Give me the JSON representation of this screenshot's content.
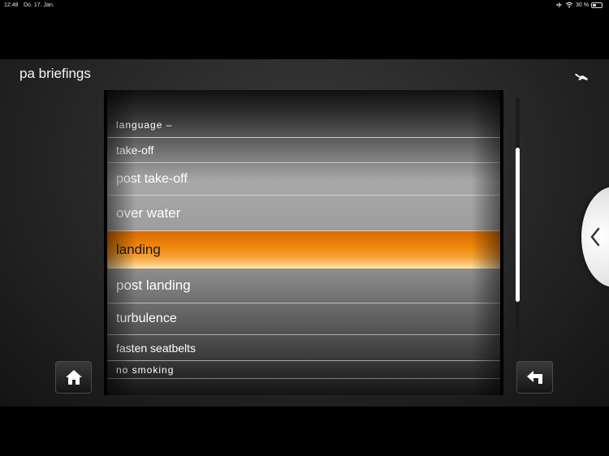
{
  "status_bar": {
    "time": "12:48",
    "date": "Do. 17. Jan.",
    "battery": "30 %",
    "icons": [
      "airplane-mode-icon",
      "wifi-icon",
      "battery-icon"
    ]
  },
  "header": {
    "title": "pa briefings",
    "right_icon": "airplane-landing-icon"
  },
  "picker": {
    "items": [
      {
        "label": "language –"
      },
      {
        "label": "take-off"
      },
      {
        "label": "post take-off"
      },
      {
        "label": "over water"
      },
      {
        "label": "landing",
        "selected": true
      },
      {
        "label": "post landing"
      },
      {
        "label": "turbulence"
      },
      {
        "label": "fasten seatbelts"
      },
      {
        "label": "no smoking"
      }
    ]
  },
  "buttons": {
    "home": "home-icon",
    "back": "back-arrow-icon",
    "side_tab": "chevron-left-icon"
  },
  "colors": {
    "selection": "#f0850a",
    "background": "#262626"
  }
}
